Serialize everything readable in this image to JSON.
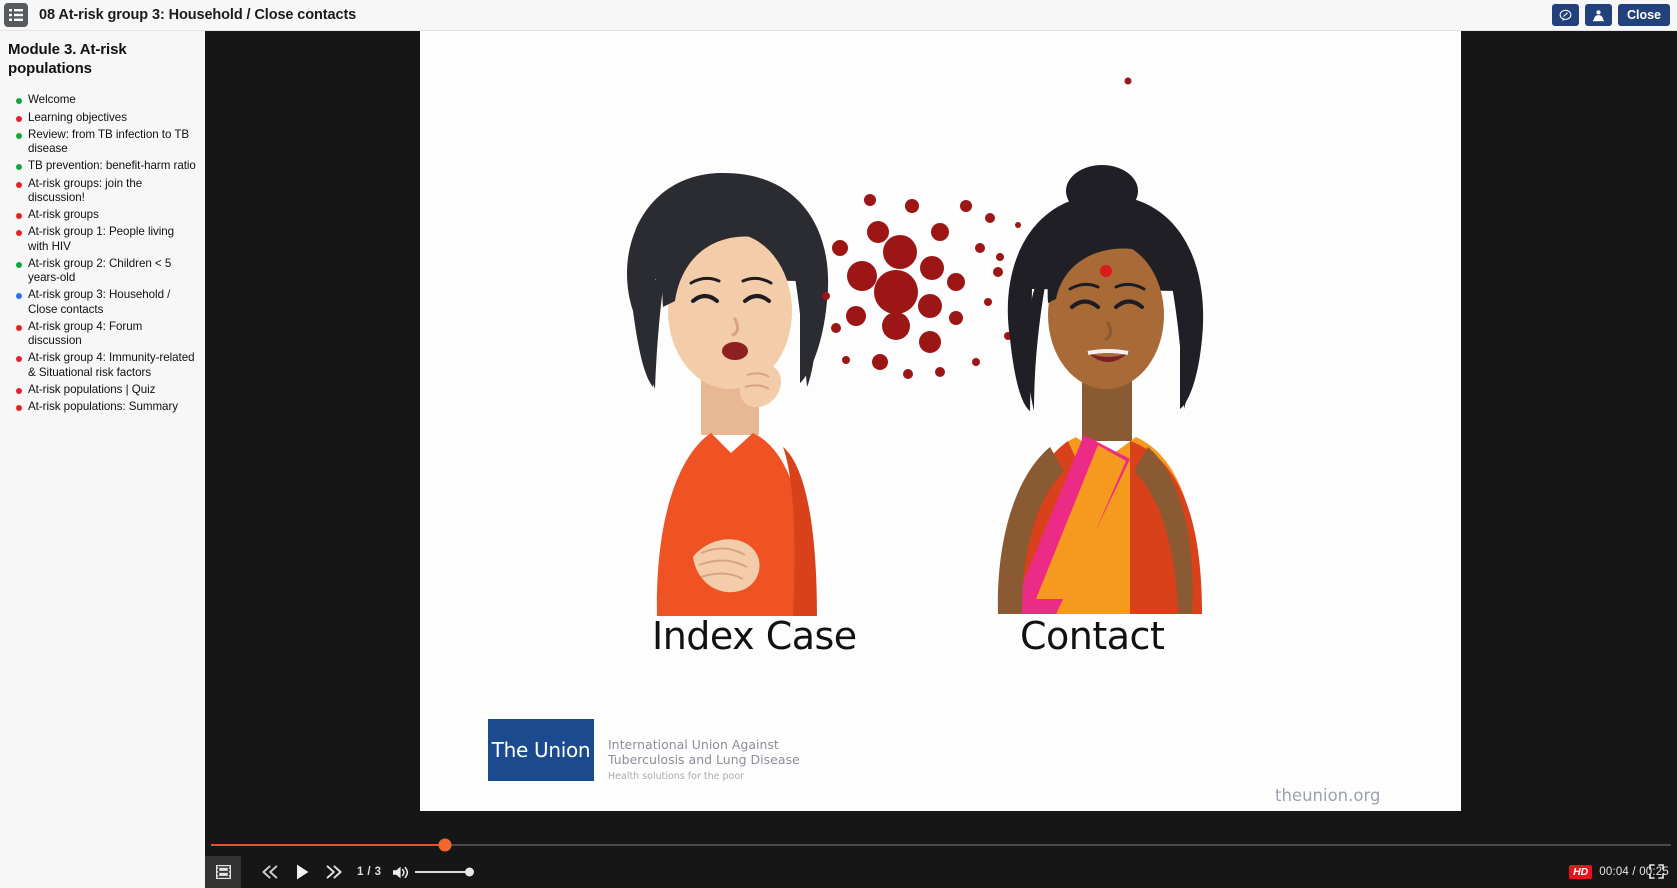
{
  "topbar": {
    "menu_icon": "list-menu-icon",
    "title": "08 At-risk group 3: Household / Close contacts",
    "notes_icon": "speech-bubble-icon",
    "presenter_icon": "presenter-icon",
    "close_label": "Close"
  },
  "sidebar": {
    "module_title": "Module 3. At-risk populations",
    "colors": {
      "done": "#10a73e",
      "todo": "#e8202a",
      "current": "#2a6df4"
    },
    "items": [
      {
        "label": "Welcome",
        "state": "done"
      },
      {
        "label": "Learning objectives",
        "state": "todo"
      },
      {
        "label": "Review: from TB infection to TB disease",
        "state": "done"
      },
      {
        "label": "TB prevention: benefit-harm ratio",
        "state": "done"
      },
      {
        "label": "At-risk groups: join the discussion!",
        "state": "todo"
      },
      {
        "label": "At-risk groups",
        "state": "todo"
      },
      {
        "label": "At-risk group 1: People living with HIV",
        "state": "todo"
      },
      {
        "label": "At-risk group 2: Children < 5 years-old",
        "state": "done"
      },
      {
        "label": "At-risk group 3: Household / Close contacts",
        "state": "current"
      },
      {
        "label": "At-risk group 4: Forum discussion",
        "state": "todo"
      },
      {
        "label": "At-risk group 4: Immunity-related & Situational risk factors",
        "state": "todo"
      },
      {
        "label": "At-risk populations | Quiz",
        "state": "todo"
      },
      {
        "label": "At-risk populations: Summary",
        "state": "todo"
      }
    ]
  },
  "slide": {
    "label_index_case": "Index Case",
    "label_contact": "Contact",
    "logo_mark_text": "The Union",
    "logo_line_1": "International Union Against",
    "logo_line_2": "Tuberculosis and Lung Disease",
    "logo_tagline": "Health solutions for the poor",
    "site_url": "theunion.org",
    "droplet_color": "#9c1616"
  },
  "controls": {
    "slides_icon": "filmstrip-icon",
    "prev_label": "«",
    "play_icon": "play-icon",
    "next_label": "»",
    "page_indicator": "1 / 3",
    "volume_icon": "volume-icon",
    "volume_level_percent": 100,
    "progress_percent": 16,
    "hd_badge": "HD",
    "time_display": "00:04 / 00:25",
    "fullscreen_icon": "fullscreen-icon",
    "accent_color": "#f2682c"
  }
}
